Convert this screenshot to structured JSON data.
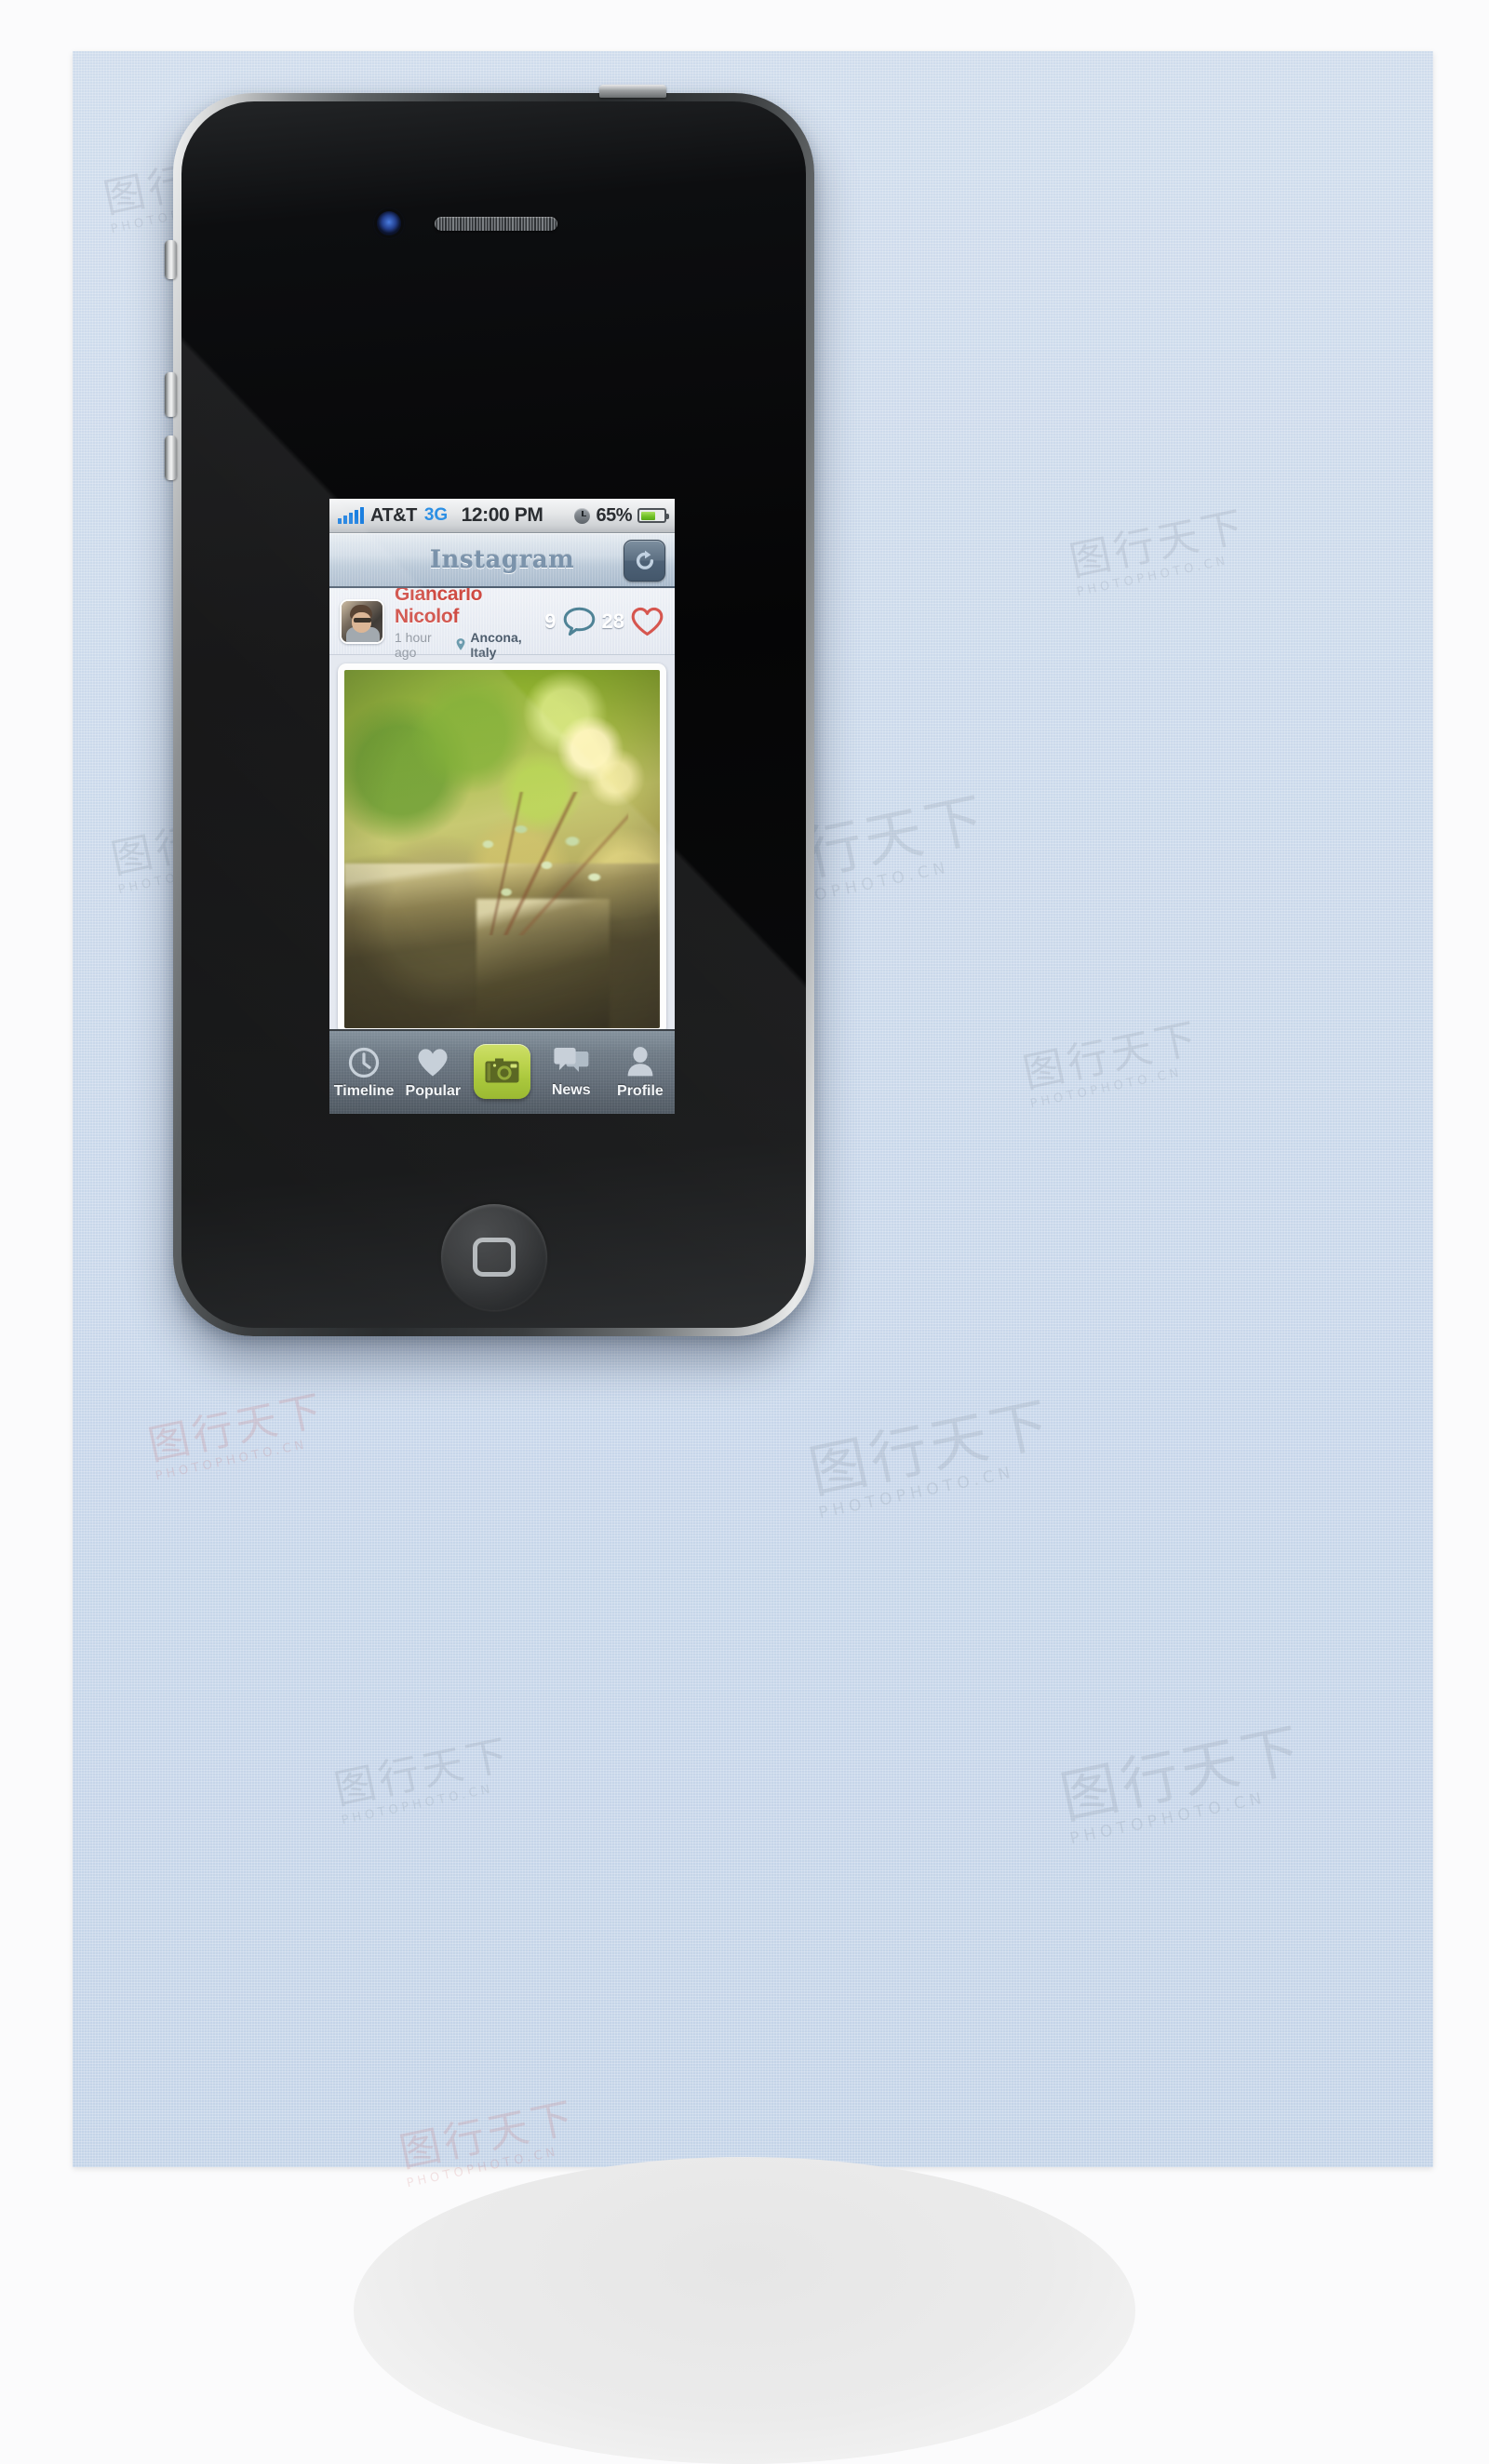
{
  "device": {
    "model": "iphone-4",
    "buttons": [
      "power-button",
      "ring-silent-switch",
      "volume-up-button",
      "volume-down-button",
      "home-button"
    ]
  },
  "status_bar": {
    "signal_icon": "signal-bars-icon",
    "signal_strength": 5,
    "carrier": "AT&T",
    "network": "3G",
    "time": "12:00 PM",
    "alarm_icon": "alarm-clock-icon",
    "battery_percent": "65%",
    "battery_level": 65,
    "battery_icon": "battery-icon"
  },
  "nav_bar": {
    "title": "Instagram",
    "refresh_icon": "refresh-icon",
    "refresh_label": "Refresh"
  },
  "post": {
    "avatar_name": "user-avatar",
    "username": "Giancarlo Nicolof",
    "timestamp": "1 hour ago",
    "location_pin_icon": "location-pin-icon",
    "location": "Ancona, Italy",
    "comment_count": "9",
    "comment_icon": "comment-bubble-icon",
    "like_count": "28",
    "like_icon": "heart-icon",
    "photo_alt": "blurred bokeh photo of green foliage and vines over stone steps"
  },
  "tab_bar": {
    "items": [
      {
        "label": "Timeline",
        "icon": "clock-icon"
      },
      {
        "label": "Popular",
        "icon": "heart-icon"
      },
      {
        "label": "",
        "icon": "camera-icon"
      },
      {
        "label": "News",
        "icon": "chat-bubbles-icon"
      },
      {
        "label": "Profile",
        "icon": "person-icon"
      }
    ]
  },
  "colors": {
    "username": "#cf4b43",
    "like": "#d6564f",
    "comment": "#4f8396",
    "network": "#2c8fe4",
    "battery": "#6dbe23",
    "camera_button": "#b5cf3e",
    "nav_title": "#7b93ab",
    "backdrop": "#c8d7ea",
    "tab_bar": "#545f6b"
  },
  "watermarks": [
    {
      "cjk": "图行天下",
      "latin": "PHOTOPHOTO.CN"
    }
  ]
}
